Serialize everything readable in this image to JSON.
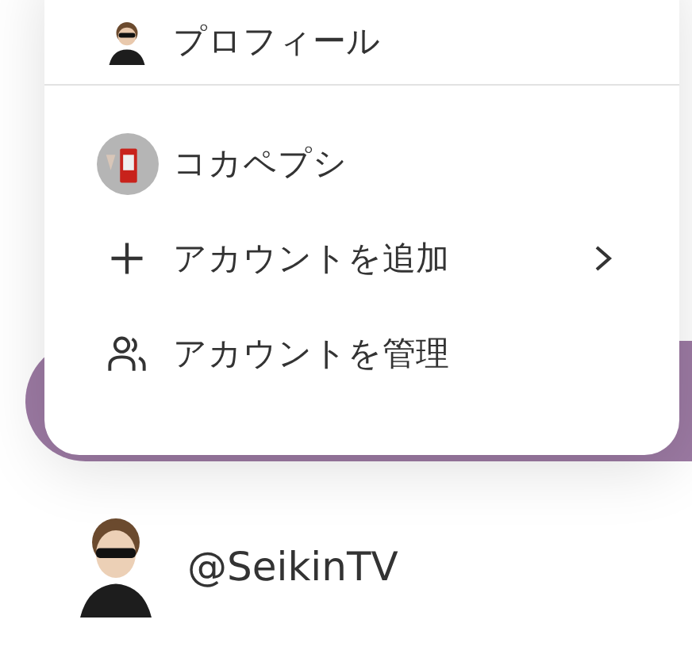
{
  "menu": {
    "sections": [
      {
        "items": [
          {
            "kind": "profile",
            "label": "プロフィール",
            "has_submenu": false
          }
        ]
      },
      {
        "items": [
          {
            "kind": "account",
            "label": "コカペプシ",
            "has_submenu": false
          },
          {
            "kind": "add",
            "label": "アカウントを追加",
            "has_submenu": true
          },
          {
            "kind": "manage",
            "label": "アカウントを管理",
            "has_submenu": false
          }
        ]
      }
    ]
  },
  "channel": {
    "handle": "@SeikinTV"
  }
}
